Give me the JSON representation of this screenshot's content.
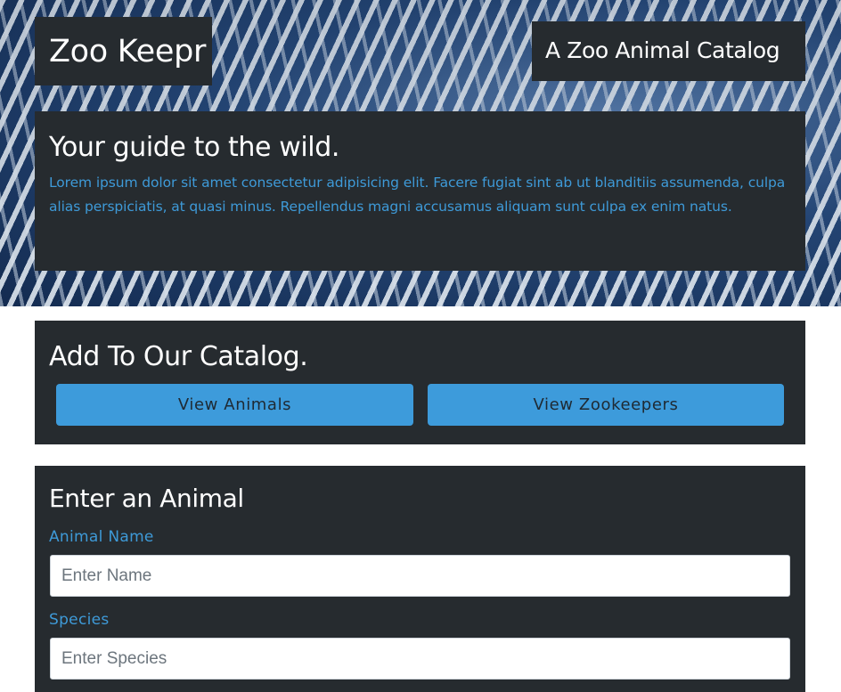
{
  "header": {
    "brand": "Zoo Keepr",
    "tagline": "A Zoo Animal Catalog"
  },
  "intro": {
    "title": "Your guide to the wild.",
    "body": "Lorem ipsum dolor sit amet consectetur adipisicing elit. Facere fugiat sint ab ut blanditiis assumenda, culpa alias perspiciatis, at quasi minus. Repellendus magni accusamus aliquam sunt culpa ex enim natus."
  },
  "catalog": {
    "title": "Add To Our Catalog.",
    "view_animals": "View Animals",
    "view_zookeepers": "View Zookeepers"
  },
  "form": {
    "title": "Enter an Animal",
    "name_label": "Animal Name",
    "name_placeholder": "Enter Name",
    "name_value": "",
    "species_label": "Species",
    "species_placeholder": "Enter Species",
    "species_value": ""
  },
  "colors": {
    "panel": "#262b2f",
    "accent": "#3e9ad8",
    "button": "#3d9bdb"
  }
}
